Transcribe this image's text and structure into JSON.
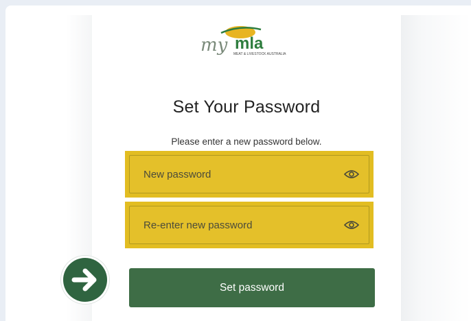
{
  "logo": {
    "prefix": "my",
    "brand": "mla",
    "tagline": "MEAT & LIVESTOCK AUSTRALIA"
  },
  "page": {
    "title": "Set Your Password",
    "subtitle": "Please enter a new password below."
  },
  "form": {
    "new_password_placeholder": "New password",
    "confirm_password_placeholder": "Re-enter new password",
    "submit_label": "Set password"
  },
  "icons": {
    "reveal": "eye-icon",
    "callout": "arrow-right-icon"
  },
  "colors": {
    "highlight": "#e2bd22",
    "primary_button": "#3e6d46",
    "callout_badge": "#2f6440",
    "logo_green": "#2e7d3e",
    "logo_sun": "#e8b421"
  }
}
